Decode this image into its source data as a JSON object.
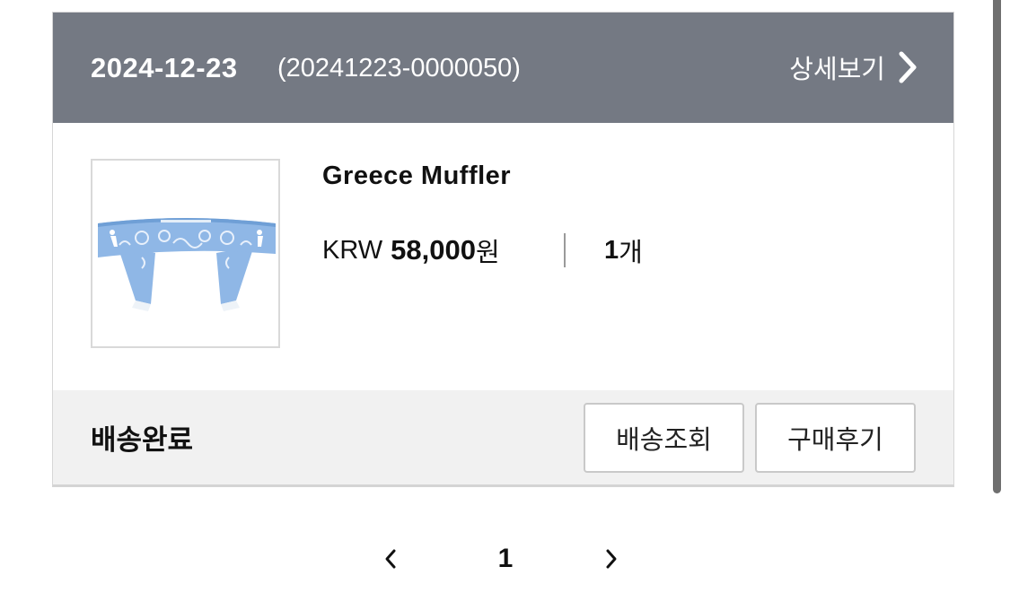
{
  "order": {
    "date": "2024-12-23",
    "number": "(20241223-0000050)",
    "detail_label": "상세보기"
  },
  "product": {
    "name": "Greece Muffler",
    "currency": "KRW",
    "price": "58,000",
    "price_unit": "원",
    "quantity": "1",
    "quantity_unit": "개",
    "thumbnail_color": "#8fb7e6"
  },
  "footer": {
    "status": "배송완료",
    "track_button": "배송조회",
    "review_button": "구매후기"
  },
  "pagination": {
    "current_page": "1",
    "prev_icon": "chevron-left-icon",
    "next_icon": "chevron-right-icon"
  },
  "colors": {
    "header_bg": "#747983",
    "footer_bg": "#f1f1f1"
  }
}
